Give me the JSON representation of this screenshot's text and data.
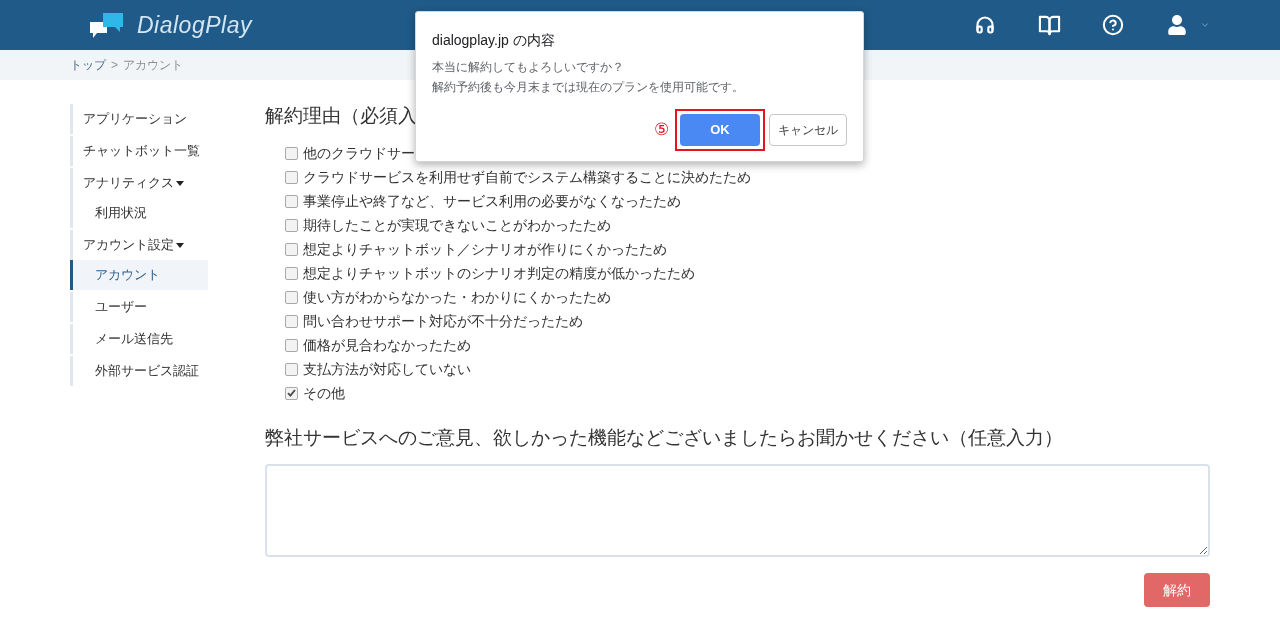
{
  "header": {
    "brand": "DialogPlay"
  },
  "breadcrumb": [
    {
      "label": "トップ",
      "kind": "link"
    },
    {
      "label": ">",
      "kind": "separator"
    },
    {
      "label": "アカウント",
      "kind": "current"
    }
  ],
  "sidebar": {
    "items": [
      {
        "label": "アプリケーション",
        "selected": false
      },
      {
        "label": "チャットボット一覧",
        "selected": false
      },
      {
        "label": "アナリティクス",
        "selected": false,
        "expanded": true,
        "children": [
          {
            "label": "利用状況",
            "selected": false
          }
        ]
      },
      {
        "label": "アカウント設定",
        "selected": false,
        "expanded": true,
        "children": [
          {
            "label": "アカウント",
            "selected": true
          },
          {
            "label": "ユーザー",
            "selected": false
          },
          {
            "label": "メール送信先",
            "selected": false
          },
          {
            "label": "外部サービス認証",
            "selected": false
          }
        ]
      }
    ]
  },
  "main": {
    "reason_heading": "解約理由（必須入",
    "reasons": [
      {
        "label": "他のクラウドサー",
        "checked": false
      },
      {
        "label": "クラウドサービスを利用せず自前でシステム構築することに決めたため",
        "checked": false
      },
      {
        "label": "事業停止や終了など、サービス利用の必要がなくなったため",
        "checked": false
      },
      {
        "label": "期待したことが実現できないことがわかったため",
        "checked": false
      },
      {
        "label": "想定よりチャットボット／シナリオが作りにくかったため",
        "checked": false
      },
      {
        "label": "想定よりチャットボットのシナリオ判定の精度が低かったため",
        "checked": false
      },
      {
        "label": "使い方がわからなかった・わかりにくかったため",
        "checked": false
      },
      {
        "label": "問い合わせサポート対応が不十分だったため",
        "checked": false
      },
      {
        "label": "価格が見合わなかったため",
        "checked": false
      },
      {
        "label": "支払方法が対応していない",
        "checked": false
      },
      {
        "label": "その他",
        "checked": true
      }
    ],
    "feedback_heading": "弊社サービスへのご意見、欲しかった機能などございましたらお聞かせください（任意入力）",
    "submit_button": "解約"
  },
  "dialog": {
    "title": "dialogplay.jp の内容",
    "message": [
      "本当に解約してもよろしいですか？",
      "解約予約後も今月末までは現在のプランを使用可能です。"
    ],
    "buttons": [
      {
        "label": "OK",
        "kind": "primary",
        "highlighted": true,
        "annotation": "⑤"
      },
      {
        "label": "キャンセル",
        "kind": "secondary",
        "highlighted": false
      }
    ]
  }
}
